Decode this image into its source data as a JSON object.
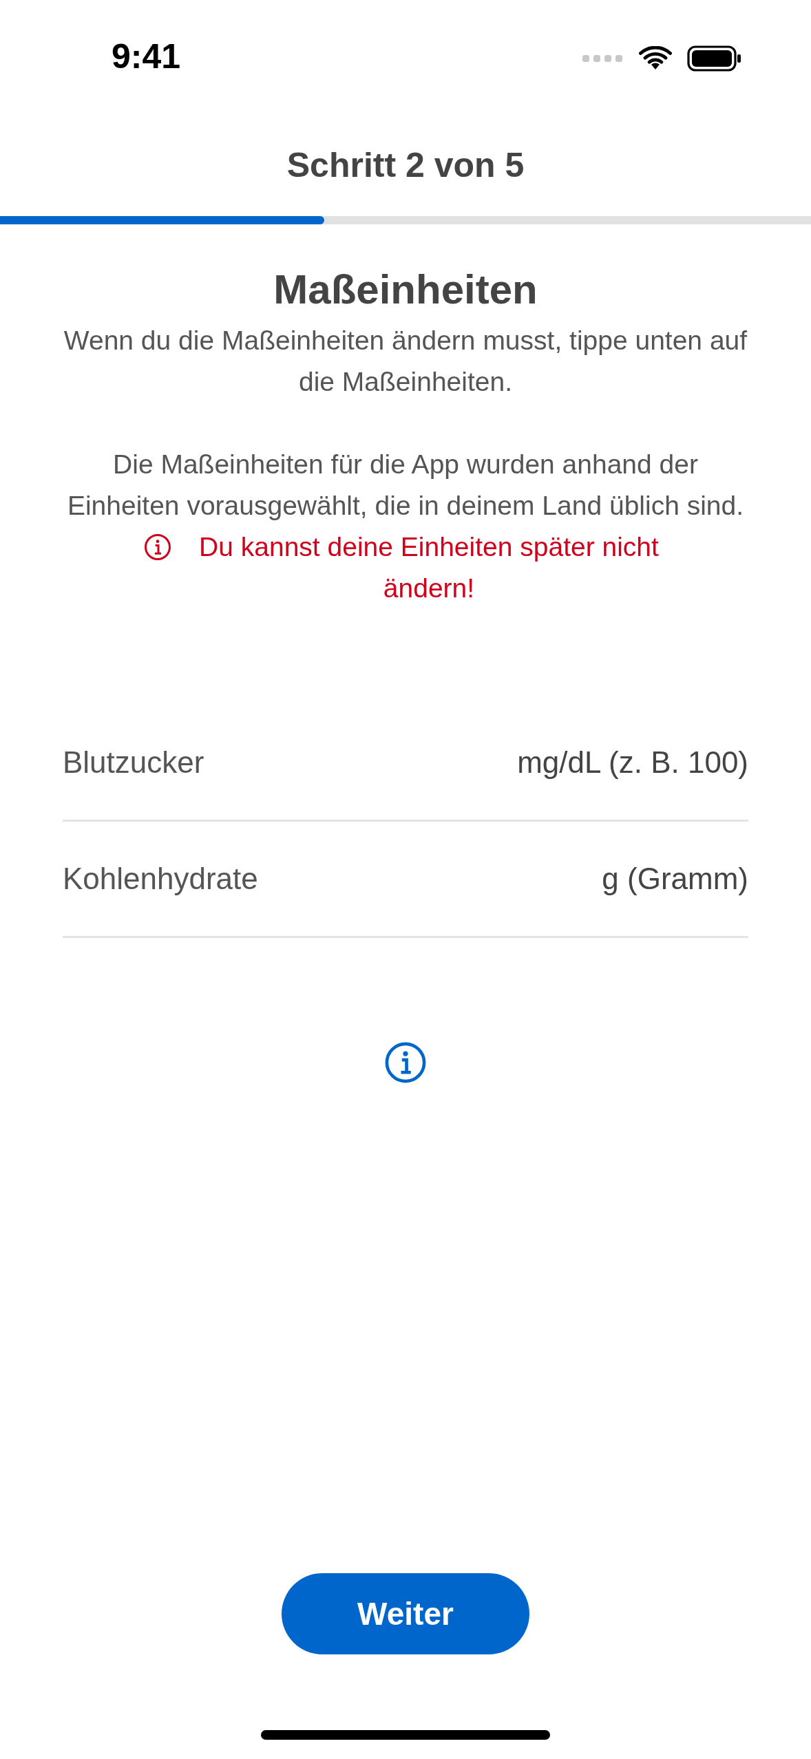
{
  "status_bar": {
    "time": "9:41"
  },
  "header": {
    "title": "Schritt 2 von 5",
    "progress": {
      "level": 0.4
    }
  },
  "title": "Maßeinheiten",
  "paragraphs": [
    "Wenn du die Maßeinheiten ändern musst, tippe unten auf die Maßeinheiten.",
    "Die Maßeinheiten für die App wurden anhand der Einheiten vorausgewählt, die in deinem Land üblich sind."
  ],
  "warning": "Du kannst deine Einheiten später nicht ändern!",
  "units": [
    {
      "label": "Blutzucker",
      "value": "mg/dL (z. B. 100)"
    },
    {
      "label": "Kohlenhydrate",
      "value": "g (Gramm)"
    }
  ],
  "button": "Weiter"
}
